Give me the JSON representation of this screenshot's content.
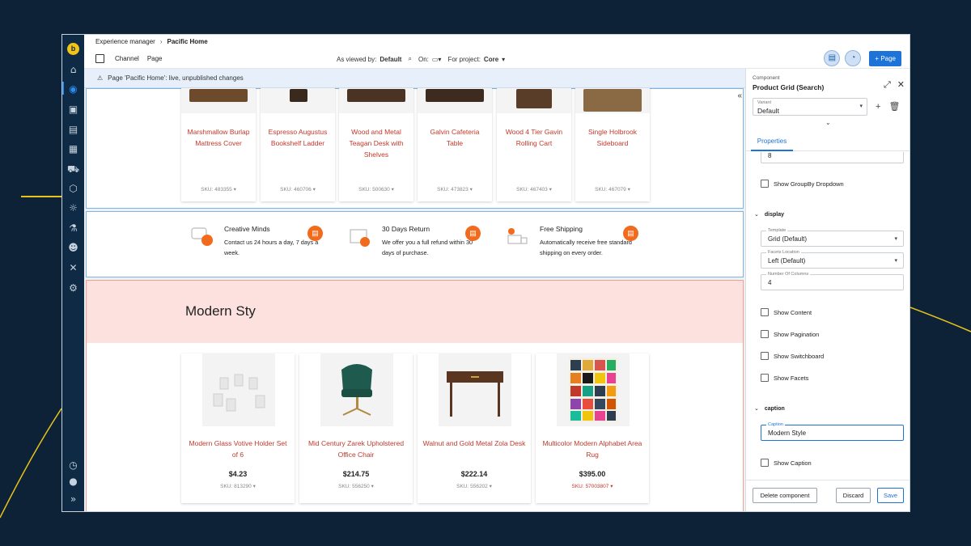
{
  "breadcrumb": {
    "root": "Experience manager",
    "current": "Pacific Home"
  },
  "toolbar": {
    "channel_label": "Channel",
    "page_label": "Page",
    "viewed_by_label": "As viewed by:",
    "viewed_by_value": "Default",
    "on_label": "On:",
    "project_label": "For project:",
    "project_value": "Core",
    "new_page_label": "Page"
  },
  "notice": "Page 'Pacific Home': live, unpublished changes",
  "products_top": [
    {
      "name": "Marshmallow Burlap Mattress Cover",
      "sku": "SKU: 483355"
    },
    {
      "name": "Espresso Augustus Bookshelf Ladder",
      "sku": "SKU: 460706"
    },
    {
      "name": "Wood and Metal Teagan Desk with Shelves",
      "sku": "SKU: 500630"
    },
    {
      "name": "Galvin Cafeteria Table",
      "sku": "SKU: 473823"
    },
    {
      "name": "Wood 4 Tier Gavin Rolling Cart",
      "sku": "SKU: 467403"
    },
    {
      "name": "Single Holbrook Sideboard",
      "sku": "SKU: 467079"
    }
  ],
  "features": [
    {
      "title": "Creative Minds",
      "desc": "Contact us 24 hours a day, 7 days a week."
    },
    {
      "title": "30 Days Return",
      "desc": "We offer you a full refund within 30 days of purchase."
    },
    {
      "title": "Free Shipping",
      "desc": "Automatically receive free standard shipping on every order."
    }
  ],
  "section_title": "Modern Sty",
  "products_grid": [
    {
      "name": "Modern Glass Votive Holder Set of 6",
      "price": "$4.23",
      "sku": "SKU: 813290"
    },
    {
      "name": "Mid Century Zarek Upholstered Office Chair",
      "price": "$214.75",
      "sku": "SKU: 556250"
    },
    {
      "name": "Walnut and Gold Metal Zola Desk",
      "price": "$222.14",
      "sku": "SKU: 556202"
    },
    {
      "name": "Multicolor Modern Alphabet Area Rug",
      "price": "$395.00",
      "sku": "SKU: 57003807"
    }
  ],
  "panel": {
    "component_label": "Component",
    "component_name": "Product Grid (Search)",
    "variant_label": "Variant",
    "variant_value": "Default",
    "tab_properties": "Properties",
    "partial_value": "8",
    "show_groupby": "Show GroupBy Dropdown",
    "group_display": "display",
    "template_label": "Template",
    "template_value": "Grid (Default)",
    "facets_location_label": "Facets Location",
    "facets_location_value": "Left (Default)",
    "num_columns_label": "Number Of Columns",
    "num_columns_value": "4",
    "show_content": "Show Content",
    "show_pagination": "Show Pagination",
    "show_switchboard": "Show Switchboard",
    "show_facets": "Show Facets",
    "group_caption": "caption",
    "caption_label": "Caption",
    "caption_value": "Modern Style",
    "show_caption": "Show Caption",
    "delete_label": "Delete component",
    "discard_label": "Discard",
    "save_label": "Save"
  },
  "colors": {
    "accent": "#1e73d8",
    "brand_yellow": "#f2c418",
    "product_red": "#c0392b",
    "badge_orange": "#f26a1b"
  }
}
